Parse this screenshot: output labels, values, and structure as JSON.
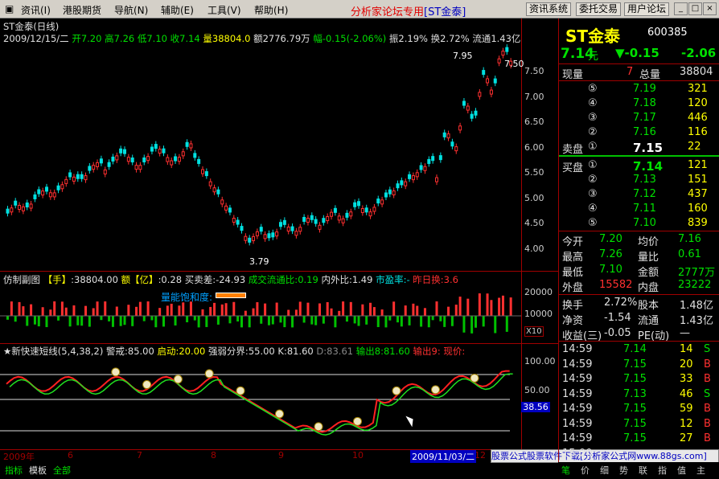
{
  "menu": {
    "items": [
      "资讯(I)",
      "港股期货",
      "导航(N)",
      "辅助(E)",
      "工具(V)",
      "帮助(H)"
    ],
    "brand": "分析家论坛专用",
    "brand_code": "[ST金泰]",
    "buttons": [
      "资讯系统",
      "委托交易",
      "用户论坛"
    ]
  },
  "chart": {
    "title": "ST金泰(日线)",
    "info_date": "2009/12/15/二",
    "info_open_label": "开",
    "info_open": "7.20",
    "info_high_label": "高",
    "info_high": "7.26",
    "info_low_label": "低",
    "info_low": "7.10",
    "info_close_label": "收",
    "info_close": "7.14",
    "info_vol_label": "量",
    "info_vol": "38804.0",
    "info_amt_label": "额",
    "info_amt": "2776.79万",
    "info_chg_label": "幅",
    "info_chg": "-0.15(-2.06%)",
    "info_amp_label": "振",
    "info_amp": "2.19%",
    "info_turn_label": "换",
    "info_turn": "2.72%",
    "info_float_label": "流通",
    "info_float": "1.43亿",
    "price_ticks": [
      "7.50",
      "7.00",
      "6.50",
      "6.00",
      "5.50",
      "5.00",
      "4.50",
      "4.00"
    ],
    "annot_high": "7.95",
    "annot_low": "3.79",
    "annot_right": "7.50",
    "vol_title": "仿制副图",
    "vol_unit": "【手】",
    "vol_value": ":38804.00",
    "vol_amt_label": "额【亿】",
    "vol_amt_value": ":0.28",
    "vol_diff_label": "买卖差:",
    "vol_diff_value": "-24.93",
    "vol_ratio_label": "成交流通比:",
    "vol_ratio_value": "0.19",
    "vol_io_label": "内外比:",
    "vol_io_value": "1.49",
    "vol_pe_label": "市盈率:",
    "vol_pe_value": "-",
    "vol_prev_label": "昨日换:",
    "vol_prev_value": "3.6",
    "vol_note": "量能饱和度:",
    "vol_ticks": [
      "20000",
      "10000"
    ],
    "vol_scale": "X10",
    "ind_title": "★新快速短线(5,4,38,2)",
    "ind_warn_label": "警戒:",
    "ind_warn": "85.00",
    "ind_start_label": "启动:",
    "ind_start": "20.00",
    "ind_div_label": "强弱分界:",
    "ind_div": "55.00",
    "ind_k_label": "K:",
    "ind_k": "81.60",
    "ind_d_label": "D:",
    "ind_d": "83.61",
    "ind_out8_label": "输出8:",
    "ind_out8": "81.60",
    "ind_out9_label": "输出9:",
    "ind_out9": "",
    "ind_cur_label": "现价:",
    "ind_cur": "",
    "ind_ticks": [
      "100.00",
      "50.00"
    ],
    "ind_marker": "38.56",
    "date_labels": [
      "2009年",
      "6",
      "7",
      "8",
      "9",
      "10",
      "11",
      "12"
    ],
    "cursor_date": "2009/11/03/二"
  },
  "panel": {
    "name": "ST金泰",
    "code": "600385",
    "price": "7.14",
    "price_unit": "元",
    "change": "▼-0.15",
    "pct": "-2.06",
    "now_vol_label": "现量",
    "now_vol": "7",
    "total_vol_label": "总量",
    "total_vol": "38804",
    "sell_label": "卖盘",
    "buy_label": "买盘",
    "asks": [
      {
        "lvl": "⑤",
        "price": "7.19",
        "vol": "321"
      },
      {
        "lvl": "④",
        "price": "7.18",
        "vol": "120"
      },
      {
        "lvl": "③",
        "price": "7.17",
        "vol": "446"
      },
      {
        "lvl": "②",
        "price": "7.16",
        "vol": "116"
      },
      {
        "lvl": "①",
        "price": "7.15",
        "vol": "22"
      }
    ],
    "bids": [
      {
        "lvl": "①",
        "price": "7.14",
        "vol": "121"
      },
      {
        "lvl": "②",
        "price": "7.13",
        "vol": "151"
      },
      {
        "lvl": "③",
        "price": "7.12",
        "vol": "437"
      },
      {
        "lvl": "④",
        "price": "7.11",
        "vol": "160"
      },
      {
        "lvl": "⑤",
        "price": "7.10",
        "vol": "839"
      }
    ],
    "stats": [
      {
        "l1": "今开",
        "v1": "7.20",
        "l2": "均价",
        "v2": "7.16"
      },
      {
        "l1": "最高",
        "v1": "7.26",
        "l2": "量比",
        "v2": "0.61"
      },
      {
        "l1": "最低",
        "v1": "7.10",
        "l2": "金额",
        "v2": "2777万"
      },
      {
        "l1": "外盘",
        "v1": "15582",
        "l2": "内盘",
        "v2": "23222"
      }
    ],
    "stats2": [
      {
        "l1": "换手",
        "v1": "2.72%",
        "l2": "股本",
        "v2": "1.48亿"
      },
      {
        "l1": "净资",
        "v1": "-1.54",
        "l2": "流通",
        "v2": "1.43亿"
      },
      {
        "l1": "收益(三)",
        "v1": "-0.05",
        "l2": "PE(动)",
        "v2": "—"
      }
    ],
    "ticks": [
      {
        "t": "14:59",
        "p": "7.14",
        "v": "14",
        "d": "S"
      },
      {
        "t": "14:59",
        "p": "7.15",
        "v": "20",
        "d": "B"
      },
      {
        "t": "14:59",
        "p": "7.15",
        "v": "33",
        "d": "B"
      },
      {
        "t": "14:59",
        "p": "7.13",
        "v": "46",
        "d": "S"
      },
      {
        "t": "14:59",
        "p": "7.15",
        "v": "59",
        "d": "B"
      },
      {
        "t": "14:59",
        "p": "7.15",
        "v": "12",
        "d": "B"
      },
      {
        "t": "14:59",
        "p": "7.15",
        "v": "27",
        "d": "B"
      },
      {
        "t": "15:00",
        "p": "",
        "v": "",
        "d": ""
      }
    ],
    "tabs_bottom": [
      "笔",
      "价",
      "细",
      "势",
      "联",
      "指",
      "值",
      "主"
    ]
  },
  "bottom_tabs": [
    "指标",
    "模板",
    "全部"
  ],
  "footer": "股票公式股票软件下载[分析家公式网www.88gs.com]",
  "colors": {
    "up": "#ff3030",
    "down": "#00e0e0",
    "green": "#00e000",
    "yellow": "#ffff00",
    "grid": "#a00000"
  }
}
